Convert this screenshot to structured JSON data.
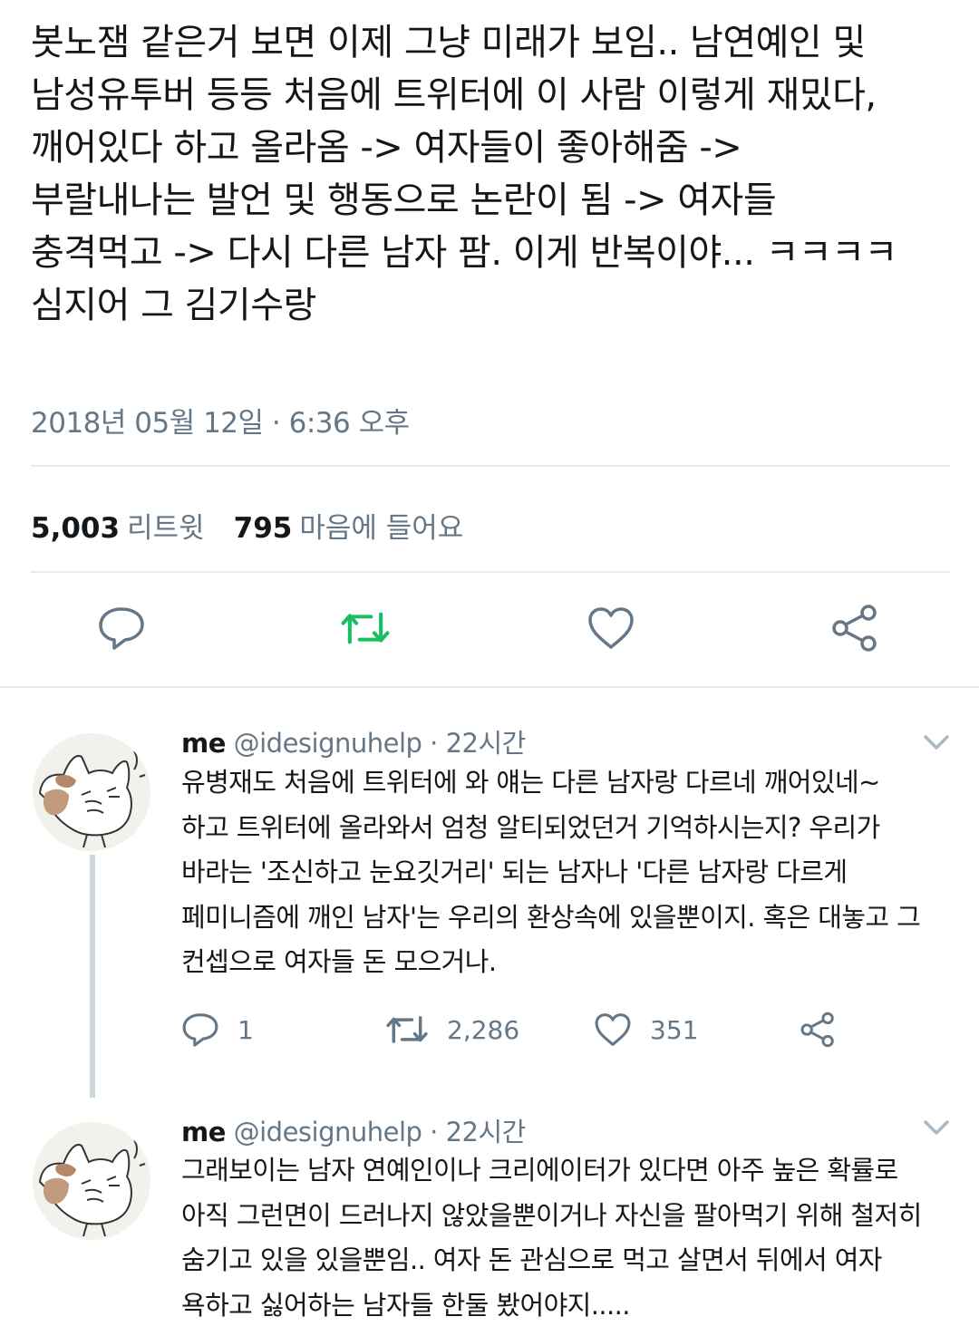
{
  "main_tweet": {
    "text": "봇노잼 같은거 보면 이제 그냥 미래가 보임.. 남연예인 및\n남성유투버 등등 처음에 트위터에 이 사람 이렇게 재밌다,\n깨어있다 하고 올라옴 -> 여자들이 좋아해줌 ->\n부랄내나는 발언 및 행동으로 논란이 됨 -> 여자들\n충격먹고 -> 다시 다른 남자 팜. 이게 반복이야... ㅋㅋㅋㅋ\n심지어 그 김기수랑",
    "timestamp": "2018년 05월 12일 · 6:36 오후",
    "retweets_count": "5,003",
    "retweets_label": "리트윗",
    "likes_count": "795",
    "likes_label": "마음에 들어요",
    "icons": [
      "reply-icon",
      "retweet-icon",
      "like-icon",
      "share-icon"
    ],
    "retweet_color": "#17bf63"
  },
  "replies": [
    {
      "name": "me",
      "handle": "@idesignuhelp",
      "dot": "·",
      "time": "22시간",
      "text": "유병재도 처음에 트위터에 와 얘는 다른 남자랑 다르네 깨어있네~\n하고 트위터에 올라와서 엄청 알티되었던거 기억하시는지? 우리가\n바라는 '조신하고 눈요깃거리' 되는 남자나 '다른 남자랑 다르게\n페미니즘에 깨인 남자'는 우리의 환상속에 있을뿐이지. 혹은 대놓고 그\n컨셉으로 여자들 돈 모으거나.",
      "reply_count": "1",
      "retweet_count": "2,286",
      "like_count": "351"
    },
    {
      "name": "me",
      "handle": "@idesignuhelp",
      "dot": "·",
      "time": "22시간",
      "text": "그래보이는 남자 연예인이나 크리에이터가 있다면 아주 높은 확률로\n아직 그런면이 드러나지 않았을뿐이거나 자신을 팔아먹기 위해 철저히\n숨기고 있을 있을뿐임.. 여자 돈 관심으로 먹고 살면서 뒤에서 여자\n욕하고 싫어하는 남자들 한둘 봤어야지....."
    }
  ],
  "colors": {
    "text": "#14171a",
    "secondary": "#657786",
    "divider": "#e6ecf0",
    "thread_line": "#ccd6dd"
  }
}
